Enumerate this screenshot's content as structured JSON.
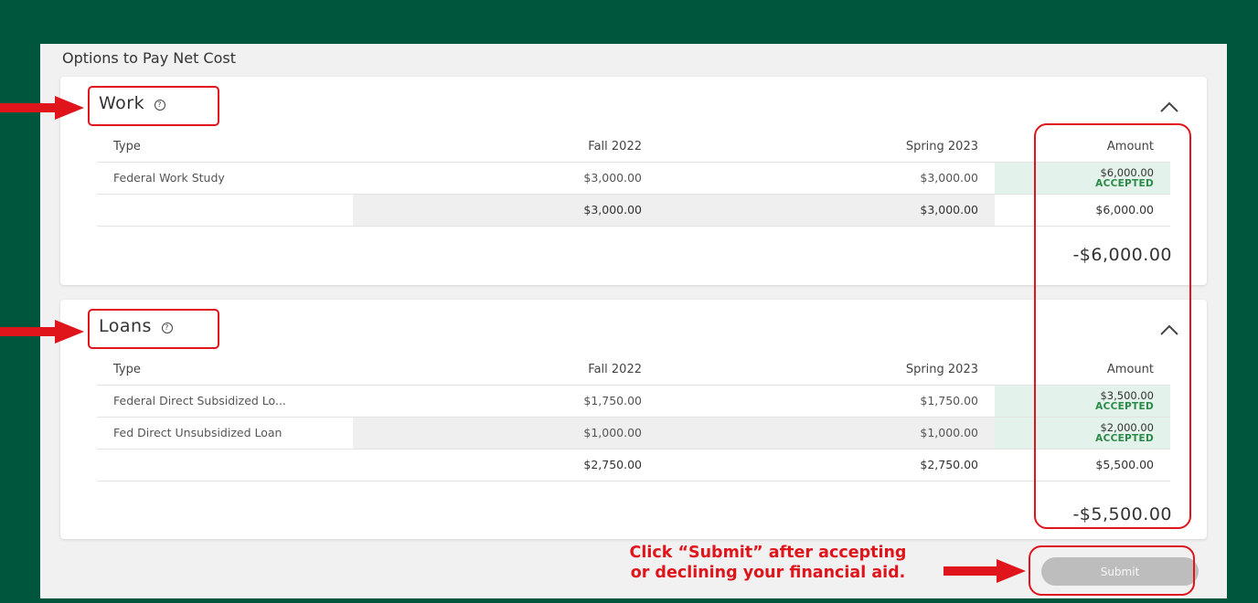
{
  "page": {
    "title": "Options to Pay Net Cost"
  },
  "work": {
    "title": "Work",
    "help_icon": "?",
    "columns": {
      "type": "Type",
      "fall": "Fall 2022",
      "spring": "Spring 2023",
      "amount": "Amount"
    },
    "rows": [
      {
        "type": "Federal Work Study",
        "fall": "$3,000.00",
        "spring": "$3,000.00",
        "amount": "$6,000.00",
        "status": "ACCEPTED"
      }
    ],
    "totals": {
      "fall": "$3,000.00",
      "spring": "$3,000.00",
      "amount": "$6,000.00"
    },
    "net": "-$6,000.00"
  },
  "loans": {
    "title": "Loans",
    "help_icon": "?",
    "columns": {
      "type": "Type",
      "fall": "Fall 2022",
      "spring": "Spring 2023",
      "amount": "Amount"
    },
    "rows": [
      {
        "type": "Federal Direct Subsidized Lo...",
        "fall": "$1,750.00",
        "spring": "$1,750.00",
        "amount": "$3,500.00",
        "status": "ACCEPTED"
      },
      {
        "type": "Fed Direct Unsubsidized Loan",
        "fall": "$1,000.00",
        "spring": "$1,000.00",
        "amount": "$2,000.00",
        "status": "ACCEPTED"
      }
    ],
    "totals": {
      "fall": "$2,750.00",
      "spring": "$2,750.00",
      "amount": "$5,500.00"
    },
    "net": "-$5,500.00"
  },
  "submit": {
    "label": "Submit"
  },
  "annotation": {
    "line1": "Click “Submit” after accepting",
    "line2": "or declining your financial aid."
  },
  "colors": {
    "background": "#00553d",
    "annotation": "#e0141b",
    "accepted": "#2a8a48",
    "submit_disabled": "#bdbdbd"
  }
}
